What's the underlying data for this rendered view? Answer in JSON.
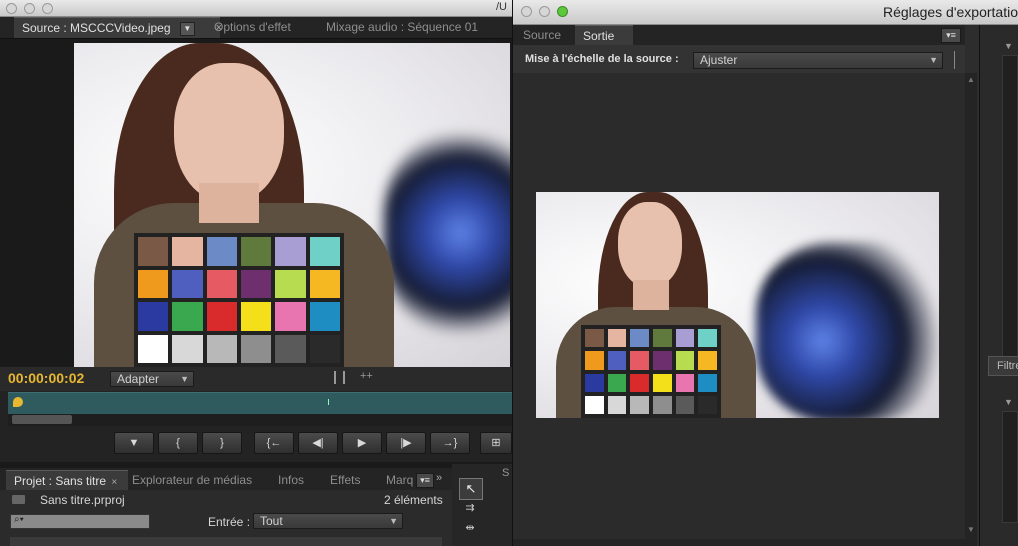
{
  "left_window": {
    "path_fragment": "/U",
    "tabs": [
      {
        "label": "Source : MSCCCVideo.jpeg",
        "active": true
      },
      {
        "label": "Options d'effet",
        "active": false
      },
      {
        "label": "Mixage audio : Séquence 01",
        "active": false
      }
    ],
    "timecode": "00:00:00:02",
    "zoom_select": "Adapter",
    "transport_buttons": [
      "marker",
      "mark-in",
      "mark-out",
      "go-to-in",
      "step-back",
      "play",
      "step-forward",
      "go-to-out",
      "insert"
    ]
  },
  "project_panel": {
    "tabs": [
      {
        "label": "Projet : Sans titre",
        "active": true
      },
      {
        "label": "Explorateur de médias",
        "active": false
      },
      {
        "label": "Infos",
        "active": false
      },
      {
        "label": "Effets",
        "active": false
      },
      {
        "label": "Marq",
        "active": false
      }
    ],
    "project_file": "Sans titre.prproj",
    "item_count": "2 éléments",
    "entry_label": "Entrée :",
    "entry_value": "Tout"
  },
  "export_window": {
    "title": "Réglages d'exportatio",
    "tabs": [
      {
        "label": "Source",
        "active": false
      },
      {
        "label": "Sortie",
        "active": true
      }
    ],
    "scale_label": "Mise à l'échelle de la source :",
    "scale_value": "Ajuster",
    "right_tab_fragment": "Filtre"
  },
  "colors": {
    "timecode": "#e8b830",
    "panel_bg": "#2b2b2b",
    "timeline": "#2f5a5e"
  },
  "chart_swatches": [
    "#7a5a47",
    "#e5b5a2",
    "#6c8bc6",
    "#5f7a3c",
    "#a99ed4",
    "#6fd0c7",
    "#f09a1d",
    "#4f5fc0",
    "#e65a63",
    "#6e2f6e",
    "#b7dc50",
    "#f5b822",
    "#2a3aa0",
    "#3aa84f",
    "#d92b2b",
    "#f3e01b",
    "#e874b0",
    "#1e8ec2",
    "#ffffff",
    "#d8d8d8",
    "#b8b8b8",
    "#8e8e8e",
    "#5a5a5a",
    "#2a2a2a"
  ]
}
